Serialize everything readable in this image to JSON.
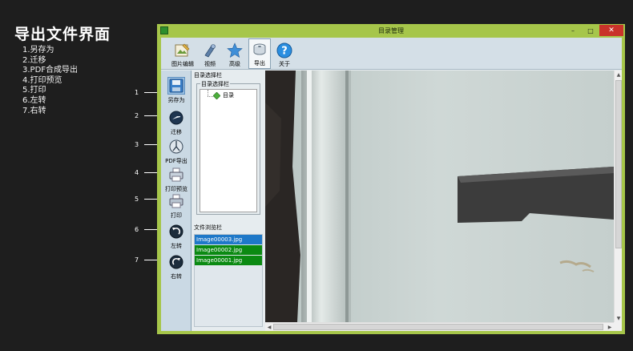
{
  "page": {
    "title": "导出文件界面",
    "legend": [
      "1.另存为",
      "2.迁移",
      "3.PDF合成导出",
      "4.打印预览",
      "5.打印",
      "6.左转",
      "7.右转"
    ],
    "callouts": [
      "1",
      "2",
      "3",
      "4",
      "5",
      "6",
      "7"
    ]
  },
  "window": {
    "title": "目录管理",
    "minimize": "–",
    "maximize": "□",
    "close": "✕"
  },
  "toolbar": {
    "items": [
      {
        "label": "图片编辑",
        "icon": "image-edit-icon"
      },
      {
        "label": "视频",
        "icon": "video-icon"
      },
      {
        "label": "高级",
        "icon": "star-icon"
      },
      {
        "label": "导出",
        "icon": "export-disk-icon"
      },
      {
        "label": "关于",
        "icon": "help-icon"
      }
    ],
    "active_index": 3
  },
  "side_toolbar": {
    "items": [
      {
        "label": "另存为",
        "icon": "save-as-icon"
      },
      {
        "label": "迁移",
        "icon": "migrate-icon"
      },
      {
        "label": "PDF导出",
        "icon": "pdf-export-icon"
      },
      {
        "label": "打印预览",
        "icon": "print-preview-icon"
      },
      {
        "label": "打印",
        "icon": "printer-icon"
      },
      {
        "label": "左转",
        "icon": "rotate-left-icon"
      },
      {
        "label": "右转",
        "icon": "rotate-right-icon"
      }
    ]
  },
  "directory_panel": {
    "caption": "目录选择栏",
    "group_title": "目录选择栏",
    "tree_root": "目录"
  },
  "file_panel": {
    "caption": "文件浏览栏",
    "files": [
      "Image00003.jpg",
      "Image00002.jpg",
      "Image00001.jpg"
    ],
    "selected_index": 0
  },
  "colors": {
    "window_frame": "#a6c64a",
    "selected_file": "#1e78c8",
    "file_row": "#0b8a12",
    "close_button": "#c9332a"
  }
}
